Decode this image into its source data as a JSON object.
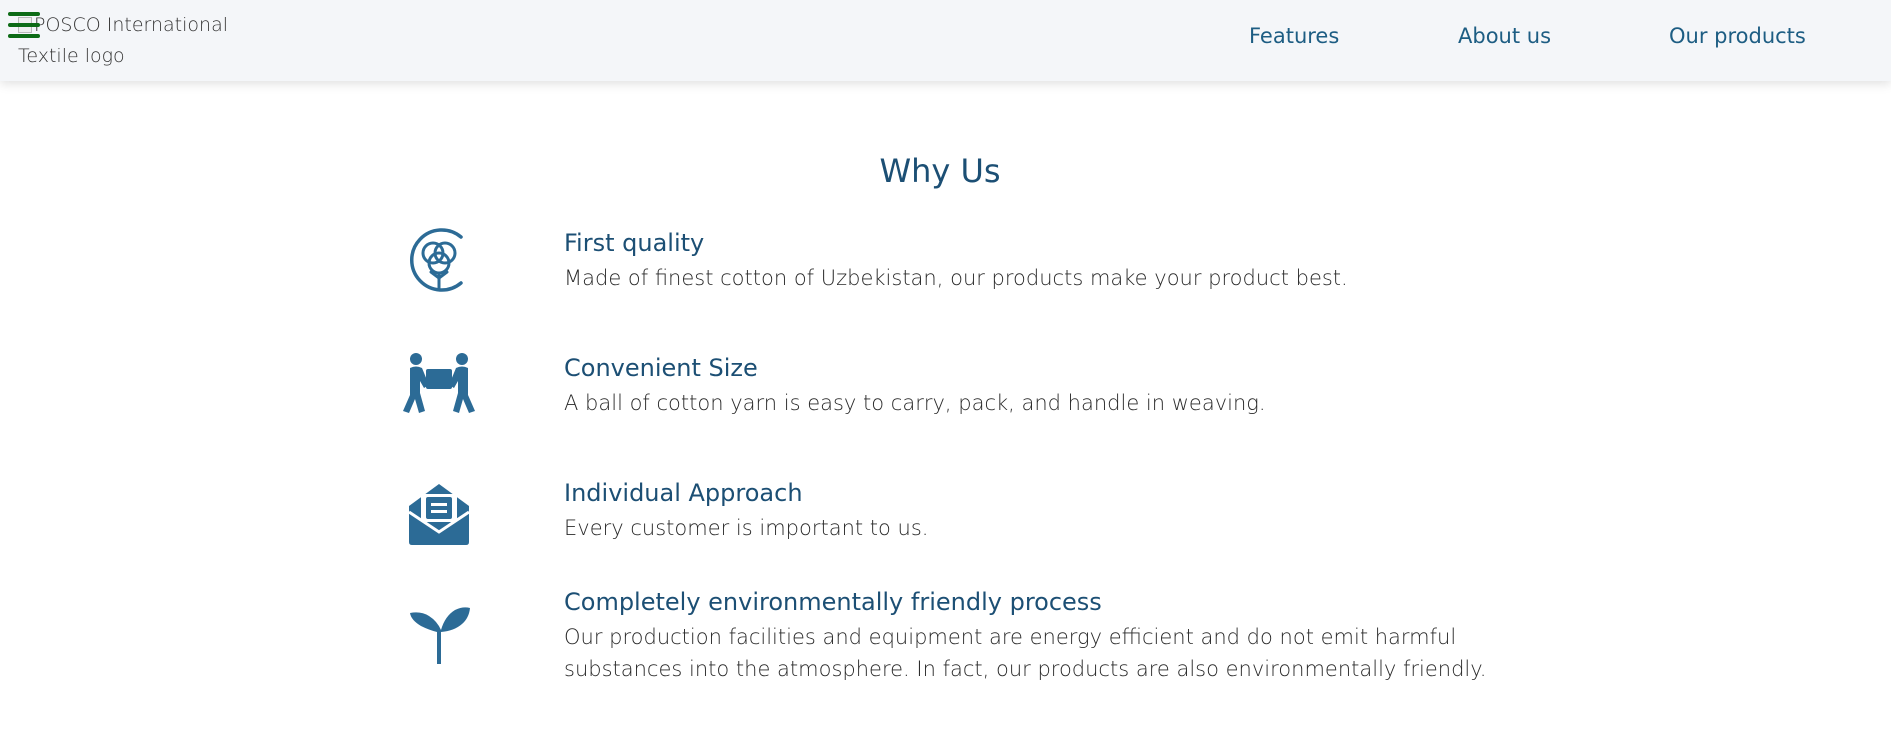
{
  "header": {
    "logo_alt": "POSCO International Textile logo",
    "menu_icon": "hamburger-menu-icon",
    "nav": [
      {
        "label": "Features"
      },
      {
        "label": "About us"
      },
      {
        "label": "Our products"
      }
    ],
    "nav_color": "#1d5d83",
    "menu_icon_color": "#0d6b16"
  },
  "main": {
    "title": "Why Us",
    "accent_color": "#2c6b96",
    "features": [
      {
        "icon": "cotton-flower-icon",
        "title": "First quality",
        "description": "Made of finest cotton of Uzbekistan, our products make your product best."
      },
      {
        "icon": "people-carrying-box-icon",
        "title": "Convenient Size",
        "description": "A ball of cotton yarn is easy to carry, pack, and handle in weaving."
      },
      {
        "icon": "envelope-letter-icon",
        "title": "Individual Approach",
        "description": "Every customer is important to us."
      },
      {
        "icon": "seedling-icon",
        "title": "Completely environmentally friendly process",
        "description": "Our production facilities and equipment are energy efficient and do not emit harmful substances into the atmosphere. In fact, our products are also environmentally friendly."
      }
    ]
  }
}
